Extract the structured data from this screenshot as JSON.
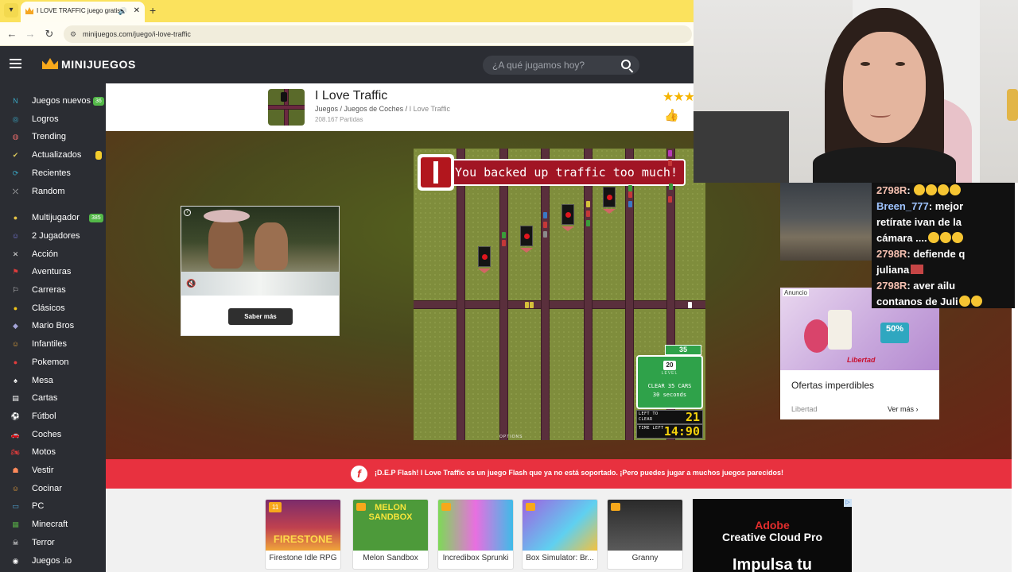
{
  "browser": {
    "tab_title": "I LOVE TRAFFIC juego gratis",
    "url": "minijuegos.com/juego/i-love-traffic"
  },
  "site": {
    "logo_text": "MINIJUEGOS",
    "search_placeholder": "¿A qué jugamos hoy?"
  },
  "sidebar": {
    "items": [
      {
        "label": "Juegos nuevos",
        "icon": "new-games-icon",
        "badge": "36",
        "badge_color": "#53b848"
      },
      {
        "label": "Logros",
        "icon": "achievements-icon",
        "badge": ""
      },
      {
        "label": "Trending",
        "icon": "trending-icon",
        "badge": ""
      },
      {
        "label": "Actualizados",
        "icon": "updated-icon",
        "badge": "",
        "dot": true
      },
      {
        "label": "Recientes",
        "icon": "recent-icon",
        "badge": ""
      },
      {
        "label": "Random",
        "icon": "random-icon",
        "badge": ""
      },
      {
        "label": "Multijugador",
        "icon": "multiplayer-icon",
        "badge": "385",
        "badge_color": "#53b848"
      },
      {
        "label": "2 Jugadores",
        "icon": "two-players-icon",
        "badge": ""
      },
      {
        "label": "Acción",
        "icon": "action-icon",
        "badge": ""
      },
      {
        "label": "Aventuras",
        "icon": "adventure-icon",
        "badge": ""
      },
      {
        "label": "Carreras",
        "icon": "racing-icon",
        "badge": ""
      },
      {
        "label": "Clásicos",
        "icon": "classics-icon",
        "badge": ""
      },
      {
        "label": "Mario Bros",
        "icon": "mario-icon",
        "badge": ""
      },
      {
        "label": "Infantiles",
        "icon": "kids-icon",
        "badge": ""
      },
      {
        "label": "Pokemon",
        "icon": "pokemon-icon",
        "badge": ""
      },
      {
        "label": "Mesa",
        "icon": "board-icon",
        "badge": ""
      },
      {
        "label": "Cartas",
        "icon": "cards-icon",
        "badge": ""
      },
      {
        "label": "Fútbol",
        "icon": "soccer-icon",
        "badge": ""
      },
      {
        "label": "Coches",
        "icon": "cars-icon",
        "badge": ""
      },
      {
        "label": "Motos",
        "icon": "motorbike-icon",
        "badge": ""
      },
      {
        "label": "Vestir",
        "icon": "dress-icon",
        "badge": ""
      },
      {
        "label": "Cocinar",
        "icon": "cooking-icon",
        "badge": ""
      },
      {
        "label": "PC",
        "icon": "pc-icon",
        "badge": ""
      },
      {
        "label": "Minecraft",
        "icon": "minecraft-icon",
        "badge": ""
      },
      {
        "label": "Terror",
        "icon": "horror-icon",
        "badge": ""
      },
      {
        "label": "Juegos .io",
        "icon": "io-icon",
        "badge": ""
      }
    ]
  },
  "game": {
    "title": "I Love Traffic",
    "breadcrumb": [
      "Juegos",
      "Juegos de Coches",
      "I Love Traffic"
    ],
    "plays": "208.167 Partidas",
    "banner_message": "You backed up traffic too much!",
    "level_count": "35",
    "level_number": "20",
    "level_label": "LEVEL",
    "level_goal": "CLEAR 35 CARS",
    "level_time": "30 seconds",
    "left_to_clear_label": "LEFT TO CLEAR",
    "left_to_clear_value": "21",
    "time_left_label": "TIME LEFT",
    "time_left_value": "14:90",
    "options_label": "OPTIONS"
  },
  "left_ad": {
    "button": "Saber más"
  },
  "right_ad": {
    "label": "Anuncio",
    "badge": "50%",
    "brand_logo": "Libertad",
    "title": "Ofertas imperdibles",
    "brand": "Libertad",
    "more": "Ver más"
  },
  "chat": [
    {
      "user": "2798R",
      "text": ""
    },
    {
      "user": "Breen_777",
      "text": "mejor"
    },
    {
      "user": "",
      "text": "retírate ivan de la"
    },
    {
      "user": "",
      "text": "cámara ...."
    },
    {
      "user": "2798R",
      "text": "defiende q"
    },
    {
      "user": "",
      "text": "juliana"
    },
    {
      "user": "2798R",
      "text": "aver ailu"
    },
    {
      "user": "",
      "text": "contanos de Juli"
    }
  ],
  "flash_notice": "¡D.E.P Flash! I Love Traffic es un juego Flash que ya no está soportado. ¡Pero puedes jugar a muchos juegos parecidos!",
  "related_games": [
    {
      "name": "Firestone Idle RPG",
      "players": "11",
      "art_text": "FIRESTONE"
    },
    {
      "name": "Melon Sandbox",
      "art_text": "MELON SANDBOX"
    },
    {
      "name": "Incredibox Sprunki",
      "art_text": ""
    },
    {
      "name": "Box Simulator: Br...",
      "art_text": ""
    },
    {
      "name": "Granny",
      "art_text": ""
    }
  ],
  "adobe_ad": {
    "brand": "Adobe",
    "product": "Creative Cloud Pro",
    "tagline": "Impulsa tu"
  },
  "colors": {
    "header_bg": "#2b2d33",
    "tab_bar": "#fbe25d",
    "flash_bar": "#e8313f",
    "game_banner": "#a11524",
    "level_green": "#2fa24a",
    "accent": "#f7a81b"
  }
}
